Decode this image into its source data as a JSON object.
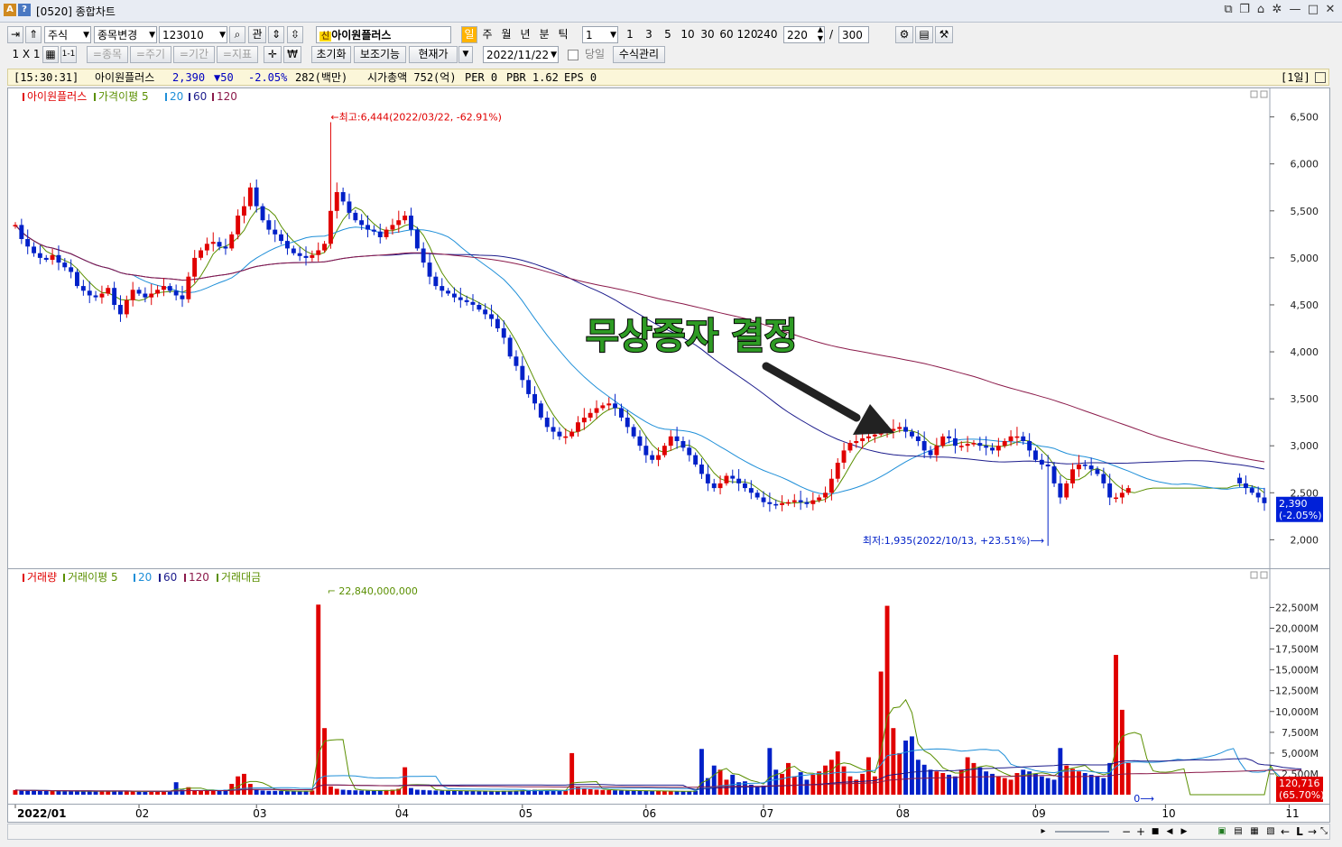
{
  "window": {
    "id_label": "[0520]",
    "title": "종합차트"
  },
  "toolbar": {
    "market": "주식",
    "change_stock": "종목변경",
    "code": "123010",
    "watch": "관",
    "stock_name": "아이원플러스",
    "new_badge": "신",
    "periods": [
      "일",
      "주",
      "월",
      "년",
      "분",
      "틱"
    ],
    "minute_select": "1",
    "minute_values": [
      "1",
      "3",
      "5",
      "10",
      "30",
      "60",
      "120",
      "240"
    ],
    "count": "220",
    "slash": "/",
    "total": "300"
  },
  "toolbar2": {
    "layout": "1 X 1",
    "layout_sub": "1-1",
    "stock_btn": "=종목",
    "cycle_btn": "=주기",
    "period_btn": "=기간",
    "indicator_btn": "=지표",
    "reset": "초기화",
    "assist": "보조기능",
    "price_type": "현재가",
    "date": "2022/11/22",
    "same_day": "당일",
    "formula": "수식관리"
  },
  "info": {
    "time": "[15:30:31]",
    "name": "아이원플러스",
    "price": "2,390",
    "change": "▼50",
    "pct": "-2.05%",
    "volume": "282(백만)",
    "mcap": "시가총액 752(억)",
    "per": "PER 0",
    "pbr": "PBR 1.62",
    "eps": "EPS 0",
    "period_tag": "[1일]"
  },
  "colors": {
    "up": "#e00000",
    "down": "#0020c8",
    "ma5": "#5a8f00",
    "ma20": "#1f8fd8",
    "ma60": "#1c1c8c",
    "ma120": "#8b1a4a",
    "overlay": "#2e9b24"
  },
  "price_legend": [
    {
      "label": "아이원플러스",
      "color": "#e00000"
    },
    {
      "label": "가격이평 5",
      "color": "#5a8f00"
    },
    {
      "label": "20",
      "color": "#1f8fd8"
    },
    {
      "label": "60",
      "color": "#1c1c8c"
    },
    {
      "label": "120",
      "color": "#8b1a4a"
    }
  ],
  "volume_legend": [
    {
      "label": "거래량",
      "color": "#e00000"
    },
    {
      "label": "거래이평 5",
      "color": "#5a8f00"
    },
    {
      "label": "20",
      "color": "#1f8fd8"
    },
    {
      "label": "60",
      "color": "#1c1c8c"
    },
    {
      "label": "120",
      "color": "#8b1a4a"
    },
    {
      "label": "거래대금",
      "color": "#5a8f00"
    }
  ],
  "chart_data": [
    {
      "type": "candlestick",
      "title": "",
      "y_ticks": [
        "6,500",
        "6,000",
        "5,500",
        "5,000",
        "4,500",
        "4,000",
        "3,500",
        "3,000",
        "2,500",
        "2,000"
      ],
      "ylim": [
        1850,
        6650
      ],
      "x_ticks": [
        "2022/01",
        "02",
        "03",
        "04",
        "05",
        "06",
        "07",
        "08",
        "09",
        "10",
        "11"
      ],
      "high_annotation": "←최고:6,444(2022/03/22, -62.91%)",
      "low_annotation": "최저:1,935(2022/10/13, +23.51%)⟶",
      "last_price_label": "2,390",
      "last_pct_label": "(-2.05%)",
      "overlay_text": "무상증자 결정",
      "closes": [
        5350,
        5200,
        5120,
        5050,
        5000,
        4980,
        5030,
        4950,
        4900,
        4850,
        4700,
        4650,
        4600,
        4580,
        4620,
        4680,
        4500,
        4400,
        4550,
        4660,
        4620,
        4580,
        4620,
        4660,
        4700,
        4650,
        4600,
        4560,
        4800,
        5000,
        5080,
        5150,
        5170,
        5120,
        5100,
        5250,
        5450,
        5550,
        5750,
        5550,
        5400,
        5300,
        5250,
        5180,
        5100,
        5050,
        5020,
        5000,
        5030,
        5080,
        5150,
        5500,
        5700,
        5600,
        5480,
        5400,
        5350,
        5300,
        5280,
        5220,
        5300,
        5350,
        5400,
        5450,
        5300,
        5100,
        4950,
        4800,
        4700,
        4650,
        4620,
        4580,
        4550,
        4530,
        4500,
        4450,
        4400,
        4350,
        4250,
        4150,
        3950,
        3850,
        3700,
        3550,
        3450,
        3300,
        3200,
        3150,
        3100,
        3100,
        3150,
        3250,
        3300,
        3350,
        3400,
        3430,
        3450,
        3400,
        3300,
        3200,
        3100,
        3000,
        2900,
        2850,
        2900,
        3000,
        3100,
        3050,
        2980,
        2900,
        2800,
        2700,
        2600,
        2550,
        2600,
        2680,
        2650,
        2600,
        2550,
        2500,
        2450,
        2400,
        2380,
        2370,
        2390,
        2400,
        2420,
        2400,
        2380,
        2420,
        2450,
        2500,
        2650,
        2820,
        2950,
        3030,
        3050,
        3080,
        3100,
        3120,
        3140,
        3160,
        3180,
        3200,
        3150,
        3100,
        3050,
        2950,
        2900,
        3000,
        3100,
        3080,
        3000,
        3000,
        3020,
        3030,
        3000,
        2980,
        2950,
        3000,
        3050,
        3100,
        3100,
        3050,
        2950,
        2850,
        2800,
        2780,
        2600,
        2450,
        2600,
        2750,
        2800,
        2790,
        2750,
        2700,
        2600,
        2450,
        2450,
        2500,
        2550,
        2550,
        2550,
        2550,
        2550,
        2550,
        2550,
        2550,
        2550,
        2550,
        2550,
        2550,
        2550,
        2550,
        2550,
        2550,
        2550,
        2660,
        2600,
        2550,
        2500,
        2450,
        2390
      ],
      "volumes": [
        550,
        520,
        480,
        500,
        460,
        470,
        440,
        430,
        420,
        410,
        400,
        400,
        390,
        380,
        420,
        460,
        430,
        400,
        390,
        380,
        370,
        360,
        380,
        400,
        420,
        480,
        1500,
        600,
        900,
        500,
        480,
        470,
        460,
        450,
        600,
        1300,
        2200,
        2500,
        1300,
        600,
        500,
        460,
        450,
        430,
        420,
        410,
        400,
        440,
        500,
        22840,
        8000,
        1000,
        700,
        600,
        550,
        520,
        500,
        480,
        470,
        500,
        550,
        600,
        700,
        3300,
        800,
        600,
        560,
        520,
        500,
        480,
        470,
        460,
        450,
        440,
        430,
        420,
        410,
        400,
        420,
        440,
        460,
        480,
        520,
        560,
        600,
        560,
        520,
        500,
        480,
        470,
        5000,
        900,
        700,
        650,
        600,
        560,
        540,
        520,
        500,
        480,
        470,
        460,
        450,
        440,
        430,
        420,
        410,
        400,
        420,
        430,
        460,
        5500,
        2000,
        3500,
        3000,
        1800,
        2400,
        1500,
        1600,
        1200,
        1000,
        1100,
        5600,
        3000,
        2500,
        3800,
        2200,
        2700,
        1800,
        2400,
        2800,
        3500,
        4200,
        5200,
        3400,
        2200,
        1800,
        2500,
        4500,
        2200,
        14800,
        22700,
        8000,
        5000,
        6500,
        7000,
        4200,
        3600,
        3000,
        2800,
        2600,
        2400,
        2200,
        3000,
        4500,
        3800,
        3300,
        2800,
        2500,
        2200,
        2000,
        1800,
        2600,
        3000,
        2800,
        2500,
        2200,
        2000,
        1800,
        5600,
        3500,
        3100,
        2800,
        2600,
        2400,
        2200,
        2000,
        3800,
        16800,
        10200,
        3800,
        2800,
        2500,
        2400,
        2800,
        3100,
        0,
        0,
        0,
        0,
        0,
        0,
        0,
        0,
        0,
        0,
        0,
        0,
        0,
        0,
        0,
        0,
        0,
        3500,
        1000,
        800,
        700,
        600,
        1200
      ],
      "volume_y_ticks": [
        "22,500M",
        "20,000M",
        "17,500M",
        "15,000M",
        "12,500M",
        "10,000M",
        "7,500M",
        "5,000M",
        "2,500M"
      ],
      "volume_ylim": [
        0,
        24500
      ],
      "volume_peak_label": "22,840,000,000",
      "last_volume_label": "120,716",
      "last_volume_pct": "(65.70%)",
      "zero_label": "0"
    }
  ]
}
